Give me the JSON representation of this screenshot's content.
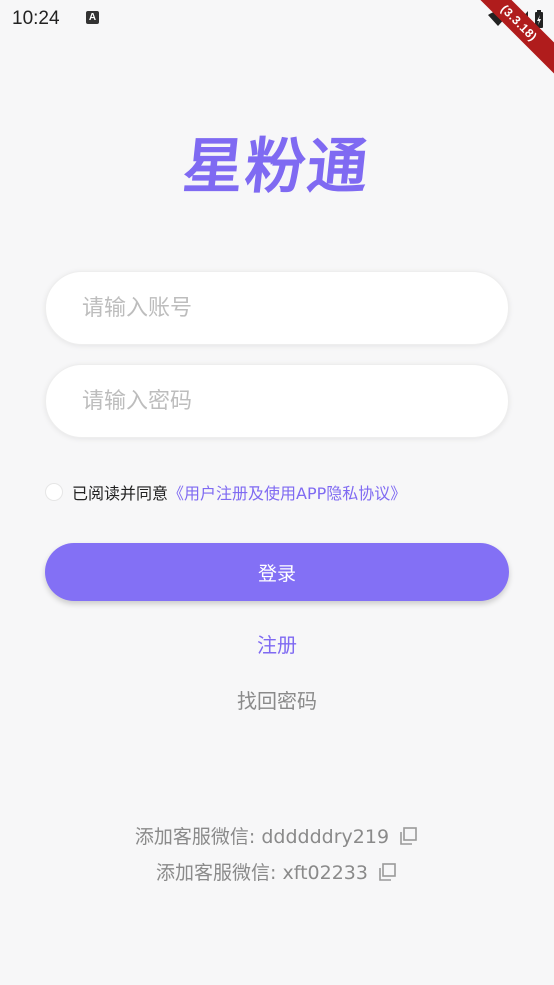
{
  "status_bar": {
    "time": "10:24",
    "a_badge": "A",
    "debug_banner": "(3.3.18)"
  },
  "app": {
    "logo_text": "星粉通"
  },
  "form": {
    "account_placeholder": "请输入账号",
    "password_placeholder": "请输入密码",
    "agree_prefix": "已阅读并同意",
    "agree_link": "《用户注册及使用APP隐私协议》",
    "login_label": "登录",
    "register_label": "注册",
    "recover_label": "找回密码"
  },
  "support": {
    "wechat_1": "添加客服微信: ddddddry219",
    "wechat_2": "添加客服微信: xft02233"
  },
  "colors": {
    "accent": "#7f6af2",
    "button": "#8370f5",
    "background": "#f7f7f8"
  }
}
